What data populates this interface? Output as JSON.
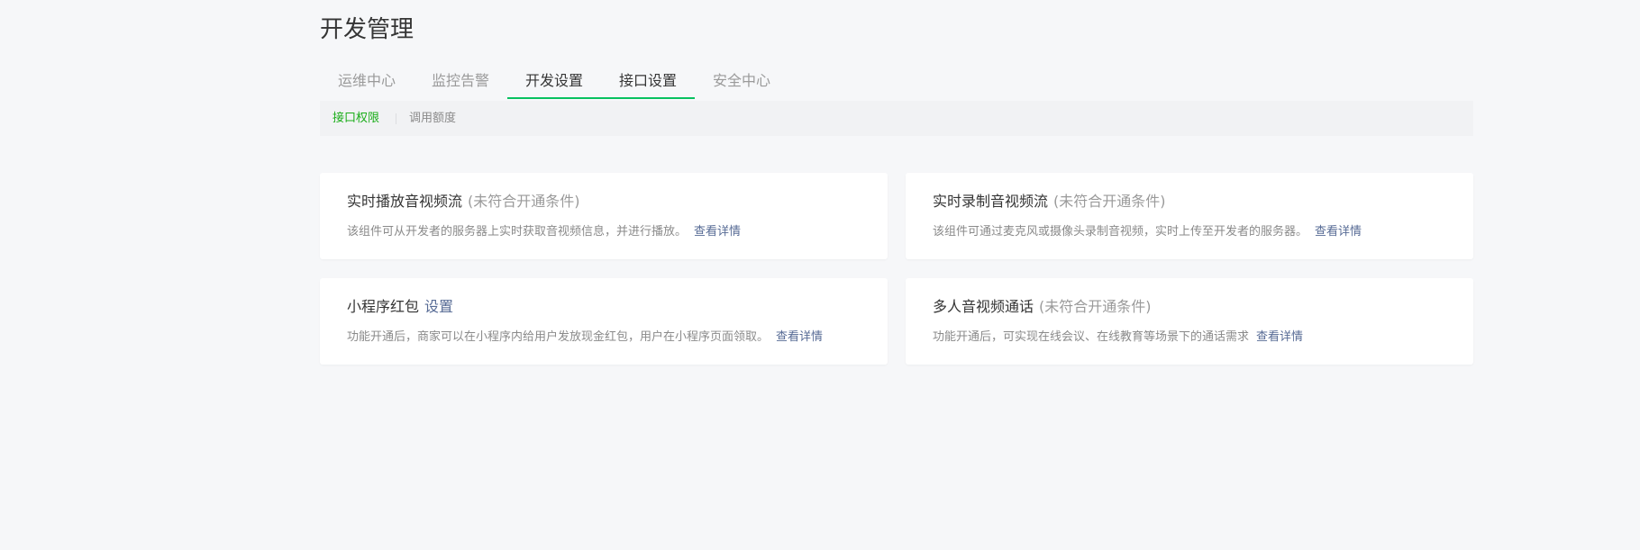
{
  "page": {
    "title": "开发管理"
  },
  "tabs": [
    {
      "label": "运维中心"
    },
    {
      "label": "监控告警"
    },
    {
      "label": "开发设置"
    },
    {
      "label": "接口设置"
    },
    {
      "label": "安全中心"
    }
  ],
  "subnav": [
    {
      "label": "接口权限"
    },
    {
      "label": "调用额度"
    }
  ],
  "cards": [
    {
      "title": "实时播放音视频流",
      "status": "(未符合开通条件)",
      "description": "该组件可从开发者的服务器上实时获取音视频信息，并进行播放。",
      "link": "查看详情"
    },
    {
      "title": "实时录制音视频流",
      "status": "(未符合开通条件)",
      "description": "该组件可通过麦克风或摄像头录制音视频，实时上传至开发者的服务器。",
      "link": "查看详情"
    },
    {
      "title": "小程序红包",
      "setup": "设置",
      "description": "功能开通后，商家可以在小程序内给用户发放现金红包，用户在小程序页面领取。",
      "link": "查看详情"
    },
    {
      "title": "多人音视频通话",
      "status": "(未符合开通条件)",
      "description": "功能开通后，可实现在线会议、在线教育等场景下的通话需求",
      "link": "查看详情"
    }
  ],
  "colors": {
    "accent_green": "#07c160",
    "link_blue": "#576b95",
    "background": "#f6f7f9"
  }
}
